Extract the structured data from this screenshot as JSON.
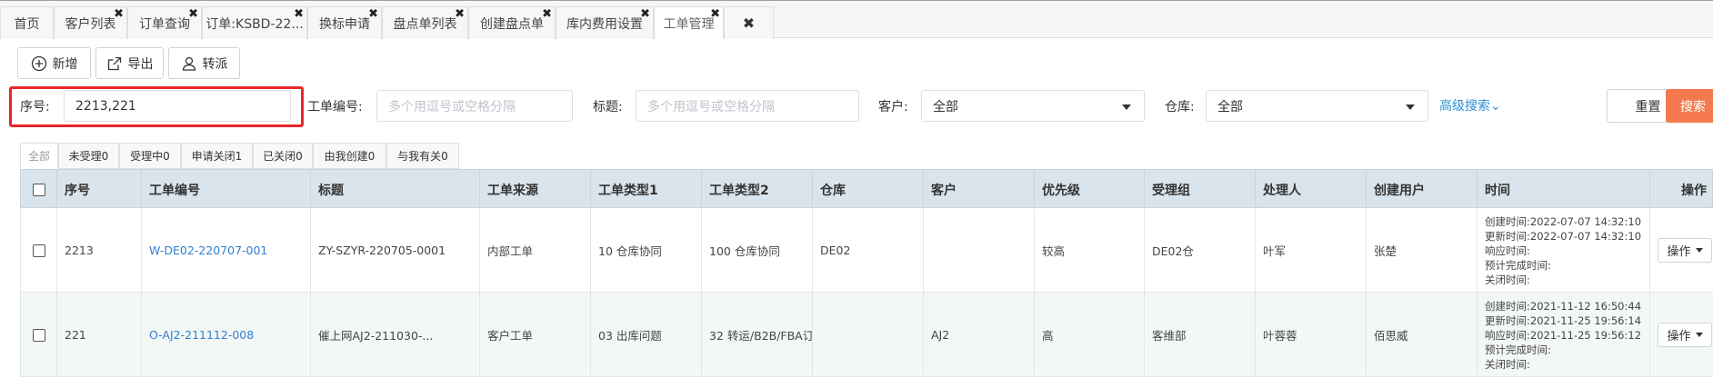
{
  "tabs": [
    {
      "label": "首页",
      "closable": false
    },
    {
      "label": "客户列表",
      "closable": true
    },
    {
      "label": "订单查询",
      "closable": true
    },
    {
      "label": "订单:KSBD-22...",
      "closable": true
    },
    {
      "label": "换标申请",
      "closable": true
    },
    {
      "label": "盘点单列表",
      "closable": true
    },
    {
      "label": "创建盘点单",
      "closable": true
    },
    {
      "label": "库内费用设置",
      "closable": true
    },
    {
      "label": "工单管理",
      "closable": true
    }
  ],
  "close_glyph": "✖",
  "close_all_glyph": "✖",
  "toolbar": {
    "add_label": "新增",
    "export_label": "导出",
    "assign_label": "转派"
  },
  "filters": {
    "seq_label": "序号:",
    "seq_value": "2213,221",
    "ticket_no_label": "工单编号:",
    "ticket_no_placeholder": "多个用逗号或空格分隔",
    "title_label": "标题:",
    "title_placeholder": "多个用逗号或空格分隔",
    "customer_label": "客户:",
    "customer_value": "全部",
    "warehouse_label": "仓库:",
    "warehouse_value": "全部",
    "advanced_search": "高级搜索",
    "advanced_chevron": "⌄",
    "reset": "重置",
    "search": "搜索"
  },
  "status_tabs": [
    "全部",
    "未受理0",
    "受理中0",
    "申请关闭1",
    "已关闭0",
    "由我创建0",
    "与我有关0"
  ],
  "table": {
    "columns": [
      "序号",
      "工单编号",
      "标题",
      "工单来源",
      "工单类型1",
      "工单类型2",
      "仓库",
      "客户",
      "优先级",
      "受理组",
      "处理人",
      "创建用户",
      "时间",
      "操作"
    ],
    "rows": [
      {
        "seq": "2213",
        "ticket_no": "W-DE02-220707-001",
        "title": "ZY-SZYR-220705-0001",
        "source": "内部工单",
        "type1": "10 仓库协同",
        "type2": "100 仓库协同",
        "warehouse": "DE02",
        "customer": "",
        "priority": "较高",
        "group": "DE02仓",
        "handler": "叶军",
        "creator": "张楚",
        "created": "创建时间:2022-07-07 14:32:10",
        "updated": "更新时间:2022-07-07 14:32:10",
        "responded": "响应时间:",
        "expected": "预计完成时间:",
        "closed": "关闭时间:",
        "op": "操作"
      },
      {
        "seq": "221",
        "ticket_no": "O-AJ2-211112-008",
        "title": "催上网AJ2-211030-...",
        "source": "客户工单",
        "type1": "03 出库问题",
        "type2": "32 转运/B2B/FBA订",
        "warehouse": "",
        "customer": "AJ2",
        "priority": "高",
        "group": "客维部",
        "handler": "叶蓉蓉",
        "creator": "佰思威",
        "created": "创建时间:2021-11-12 16:50:44",
        "updated": "更新时间:2021-11-25 19:56:14",
        "responded": "响应时间:2021-11-25 19:56:12",
        "expected": "预计完成时间:",
        "closed": "关闭时间:",
        "op": "操作"
      }
    ]
  }
}
